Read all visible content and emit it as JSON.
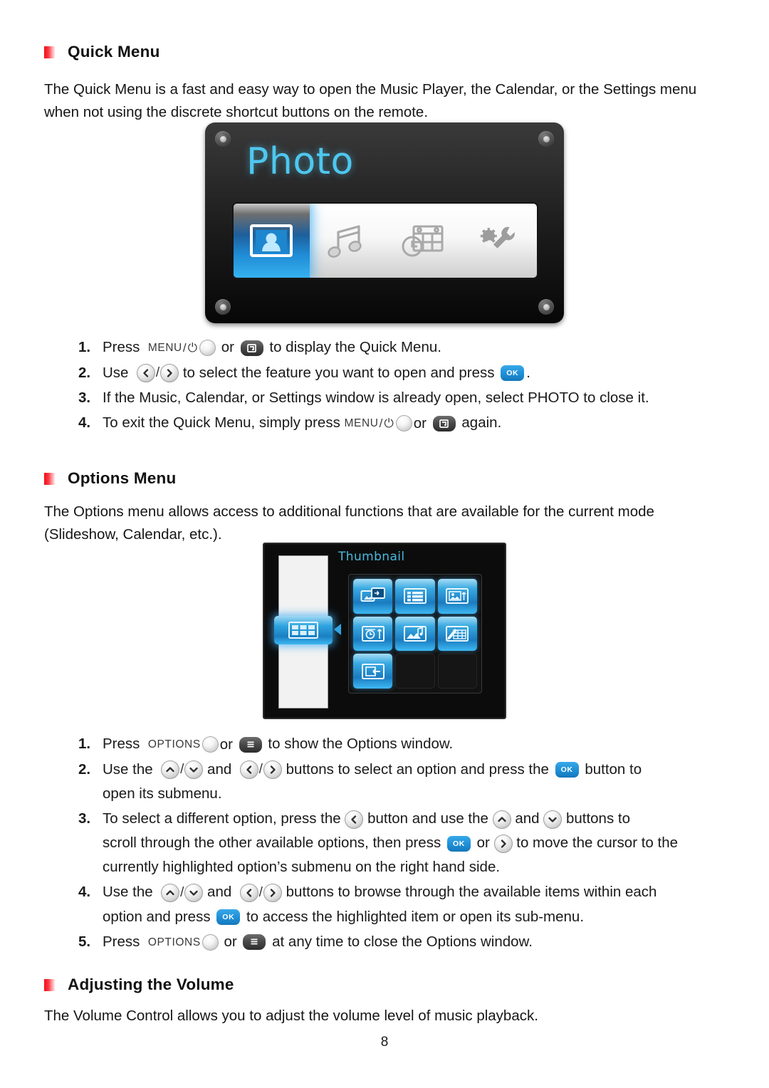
{
  "page": {
    "number": "8"
  },
  "sections": {
    "quick_menu": {
      "heading": "Quick Menu",
      "intro": "The Quick Menu is a fast and easy way to open the Music Player, the Calendar, or the Settings menu when not using the discrete shortcut buttons on the remote.",
      "screenshot": {
        "title": "Photo",
        "icons": [
          "photo-icon",
          "music-note-icon",
          "calendar-clock-icon",
          "gear-wrench-icon"
        ],
        "selected_index": 0
      },
      "steps": [
        {
          "num": "1.",
          "parts": [
            "Press",
            "MENU",
            "/",
            "power-glyph",
            "round-button",
            "or",
            "quickmenu-key",
            "to display the Quick Menu."
          ]
        },
        {
          "num": "2.",
          "parts": [
            "Use",
            "left-button",
            "/",
            "right-button",
            "to select the feature you want to open and press",
            "ok-button",
            "."
          ]
        },
        {
          "num": "3.",
          "parts": [
            "If the Music, Calendar, or Settings window is already open, select PHOTO to close it."
          ]
        },
        {
          "num": "4.",
          "parts": [
            "To exit the Quick Menu, simply press",
            "MENU",
            "/",
            "power-glyph",
            "round-button",
            "or",
            "quickmenu-key",
            "again."
          ]
        }
      ],
      "step_text": {
        "s1_press": "Press",
        "s1_menu": "MENU",
        "s1_slash": "/",
        "s1_power": "⏻",
        "s1_or": "or",
        "s1_tail": "to display the Quick Menu.",
        "s2_use": "Use",
        "s2_mid": "to select the feature you want to open and press",
        "s2_period": ".",
        "s3_text": "If the Music, Calendar, or Settings window is already open, select PHOTO to close it.",
        "s4_lead": "To exit the Quick Menu, simply press",
        "s4_menu": "MENU",
        "s4_slash": "/",
        "s4_power": "⏻",
        "s4_or": "or",
        "s4_tail": "again."
      }
    },
    "options_menu": {
      "heading": "Options Menu",
      "intro": "The Options menu allows access to additional functions that are available for the current mode (Slideshow, Calendar, etc.).",
      "screenshot": {
        "title": "Thumbnail",
        "sidebar_selected_icon": "thumbnail-grid-icon",
        "grid_icons": [
          "slideshow-transition-icon",
          "list-view-icon",
          "photo-frame-icon",
          "clock-slideshow-icon",
          "music-slideshow-icon",
          "edit-calendar-icon",
          "exit-back-icon"
        ],
        "grid_empty_cells": 2
      },
      "step_text": {
        "s1_press": "Press",
        "s1_options": "OPTIONS",
        "s1_or": "or",
        "s1_tail": "to show the Options window.",
        "s2_use": "Use the",
        "s2_and": "and",
        "s2_mid": "buttons to select an option and press the",
        "s2_tail": "button to",
        "s2_line2": "open its submenu.",
        "s3_lead": "To select a different option, press the",
        "s3_mid1": "button and use the",
        "s3_and": "and",
        "s3_mid2": "buttons to",
        "s3_line2a": "scroll through the other available options, then press",
        "s3_or": "or",
        "s3_line2b": "to move the cursor to the",
        "s3_line3": "currently highlighted option’s submenu on the right hand side.",
        "s4_use": "Use the",
        "s4_and": "and",
        "s4_mid": "buttons to browse through the available items within each",
        "s4_line2a": "option and press",
        "s4_line2b": "to access the highlighted item or open its sub-menu.",
        "s5_press": "Press",
        "s5_options": "OPTIONS",
        "s5_or": "or",
        "s5_tail": "at any time to close the Options window."
      },
      "step_numbers": {
        "n1": "1.",
        "n2": "2.",
        "n3": "3.",
        "n4": "4.",
        "n5": "5."
      }
    },
    "volume": {
      "heading": "Adjusting the Volume",
      "intro": "The Volume Control allows you to adjust the volume level of music playback."
    }
  },
  "keys": {
    "ok_label": "OK",
    "menu_label": "MENU",
    "options_label": "OPTIONS",
    "power_symbol": "⏻",
    "slash": "/"
  },
  "colors": {
    "bullet_red": "#f20c18",
    "ok_blue": "#1f8fd6",
    "screen_cyan": "#4ec7ef",
    "panel_blue": "#39a9e2",
    "text": "#161616"
  }
}
